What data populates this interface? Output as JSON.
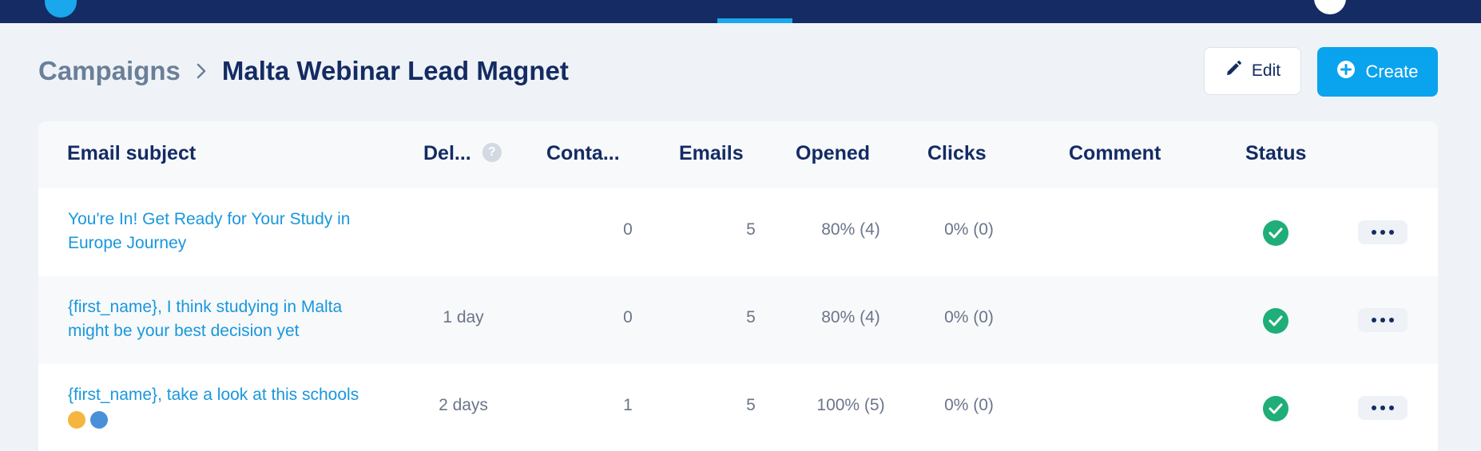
{
  "breadcrumb": {
    "root": "Campaigns",
    "current": "Malta Webinar Lead Magnet"
  },
  "toolbar": {
    "edit_label": "Edit",
    "create_label": "Create"
  },
  "colors": {
    "nav_bg": "#142b63",
    "accent": "#0aa3ee",
    "link": "#1a97dc",
    "success": "#1fae78"
  },
  "icons": {
    "edit": "pencil-icon",
    "create": "plus-circle-icon",
    "status": "check-circle-icon",
    "help": "question-mark-icon",
    "more": "more-options-icon"
  },
  "table": {
    "columns": {
      "subject": "Email subject",
      "delay": "Del...",
      "contacts": "Conta...",
      "emails": "Emails",
      "opened": "Opened",
      "clicks": "Clicks",
      "comment": "Comment",
      "status": "Status"
    },
    "help_glyph": "?",
    "rows": [
      {
        "subject_line1": "You're In! Get Ready for Your Study in",
        "subject_line2": "Europe Journey",
        "delay": "",
        "contacts": "0",
        "emails": "5",
        "opened": "80% (4)",
        "clicks": "0% (0)",
        "comment": "",
        "status": "sent"
      },
      {
        "subject_line1": "{first_name}, I think studying in Malta",
        "subject_line2": "might be your best decision yet",
        "delay": "1 day",
        "contacts": "0",
        "emails": "5",
        "opened": "80% (4)",
        "clicks": "0% (0)",
        "comment": "",
        "status": "sent"
      },
      {
        "subject_line1": "{first_name}, take a look at this schools",
        "subject_line2": "",
        "delay": "2 days",
        "contacts": "1",
        "emails": "5",
        "opened": "100% (5)",
        "clicks": "0% (0)",
        "comment": "",
        "status": "sent"
      }
    ]
  }
}
